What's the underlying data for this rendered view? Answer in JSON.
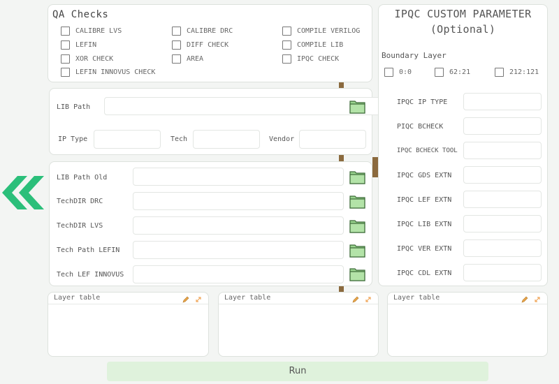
{
  "qa_checks": {
    "title": "QA Checks",
    "items": [
      {
        "label": "CALIBRE LVS"
      },
      {
        "label": "CALIBRE DRC"
      },
      {
        "label": "COMPILE VERILOG"
      },
      {
        "label": "LEFIN"
      },
      {
        "label": "DIFF CHECK"
      },
      {
        "label": "COMPILE LIB"
      },
      {
        "label": "XOR CHECK"
      },
      {
        "label": "AREA"
      },
      {
        "label": "IPQC CHECK"
      },
      {
        "label": "LEFIN INNOVUS CHECK"
      }
    ]
  },
  "lib_section": {
    "lib_path_label": "LIB Path",
    "ip_type_label": "IP Type",
    "tech_label": "Tech",
    "vendor_label": "Vendor"
  },
  "old_section": {
    "rows": [
      {
        "label": "LIB Path Old"
      },
      {
        "label": "TechDIR DRC"
      },
      {
        "label": "TechDIR LVS"
      },
      {
        "label": "Tech Path LEFIN"
      },
      {
        "label": "Tech LEF INNOVUS"
      }
    ]
  },
  "ipqc": {
    "title_line1": "IPQC CUSTOM PARAMETER",
    "title_line2": "(Optional)",
    "boundary_layer_label": "Boundary Layer",
    "boundary_options": [
      {
        "label": "0:0"
      },
      {
        "label": "62:21"
      },
      {
        "label": "212:121"
      }
    ],
    "params": [
      {
        "label": "IPQC IP TYPE"
      },
      {
        "label": "PIQC BCHECK"
      },
      {
        "label": "IPQC BCHECK TOOL"
      },
      {
        "label": "IPQC GDS EXTN"
      },
      {
        "label": "IPQC LEF EXTN"
      },
      {
        "label": "IPQC LIB EXTN"
      },
      {
        "label": "IPQC VER EXTN"
      },
      {
        "label": "IPQC CDL EXTN"
      }
    ]
  },
  "layer_tables": [
    {
      "title": "Layer table"
    },
    {
      "title": "Layer table"
    },
    {
      "title": "Layer table"
    }
  ],
  "run_button": {
    "label": "Run"
  },
  "icons": {
    "back": "double-chevron-left-icon",
    "folder": "folder-icon",
    "edit": "pencil-icon",
    "expand": "expand-icon"
  },
  "colors": {
    "accent_green": "#2bbf7a",
    "folder_green": "#9ad48f",
    "run_bg": "#dff2dc",
    "handle": "#8b6a3e"
  }
}
